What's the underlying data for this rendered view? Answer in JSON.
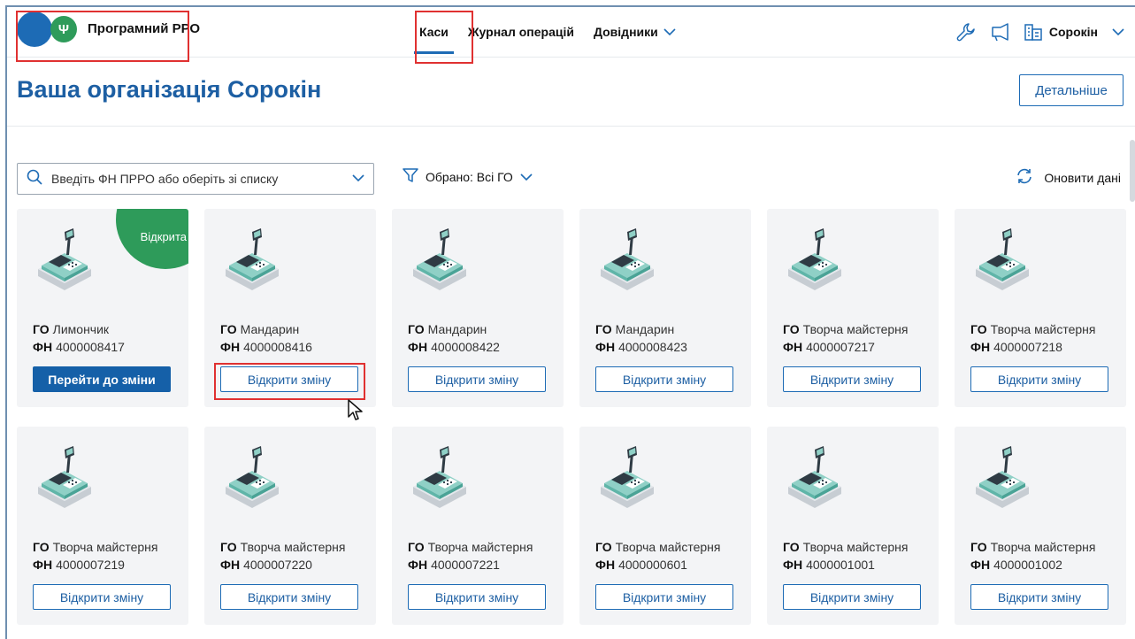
{
  "header": {
    "logo_text": "Програмний РРО",
    "nav": [
      {
        "label": "Каси",
        "active": true
      },
      {
        "label": "Журнал операцій",
        "active": false
      },
      {
        "label": "Довідники",
        "active": false,
        "dropdown": true
      }
    ],
    "user_name": "Сорокін",
    "icons": [
      "wrench-icon",
      "megaphone-icon",
      "building-icon",
      "chevron-down-icon"
    ]
  },
  "page": {
    "title": "Ваша організація Сорокін",
    "detail_button": "Детальніше"
  },
  "filters": {
    "search_placeholder": "Введіть ФН ПРРО або оберіть зі списку",
    "selected_label": "Обрано: Всі ГО",
    "refresh_label": "Оновити дані"
  },
  "labels": {
    "go": "ГО",
    "fn": "ФН",
    "open_badge": "Відкрита"
  },
  "cards": [
    {
      "go": "Лимончик",
      "fn": "4000008417",
      "status_badge": "Відкрита",
      "button": "Перейти до зміни",
      "primary": true
    },
    {
      "go": "Мандарин",
      "fn": "4000008416",
      "button": "Відкрити зміну",
      "primary": false
    },
    {
      "go": "Мандарин",
      "fn": "4000008422",
      "button": "Відкрити зміну",
      "primary": false
    },
    {
      "go": "Мандарин",
      "fn": "4000008423",
      "button": "Відкрити зміну",
      "primary": false
    },
    {
      "go": "Творча майстерня",
      "fn": "4000007217",
      "button": "Відкрити зміну",
      "primary": false
    },
    {
      "go": "Творча майстерня",
      "fn": "4000007218",
      "button": "Відкрити зміну",
      "primary": false
    },
    {
      "go": "Творча майстерня",
      "fn": "4000007219",
      "button": "Відкрити зміну",
      "primary": false
    },
    {
      "go": "Творча майстерня",
      "fn": "4000007220",
      "button": "Відкрити зміну",
      "primary": false
    },
    {
      "go": "Творча майстерня",
      "fn": "4000007221",
      "button": "Відкрити зміну",
      "primary": false
    },
    {
      "go": "Творча майстерня",
      "fn": "4000000601",
      "button": "Відкрити зміну",
      "primary": false
    },
    {
      "go": "Творча майстерня",
      "fn": "4000001001",
      "button": "Відкрити зміну",
      "primary": false
    },
    {
      "go": "Творча майстерня",
      "fn": "4000001002",
      "button": "Відкрити зміну",
      "primary": false
    }
  ],
  "colors": {
    "primary": "#1d6bb5",
    "title": "#1d5fa3",
    "open_green": "#2e9b5a",
    "card_bg": "#f3f4f6",
    "highlight": "#e03131"
  }
}
